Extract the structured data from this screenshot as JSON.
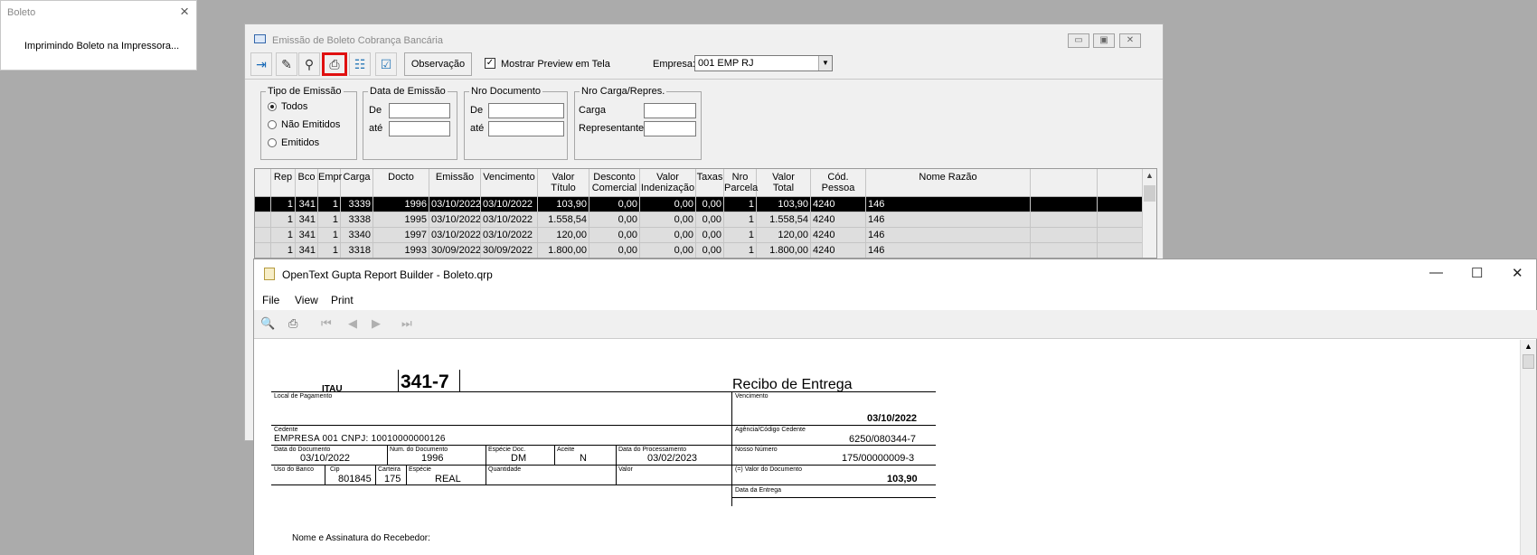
{
  "popup": {
    "title": "Boleto",
    "close": "×",
    "message": "Imprimindo Boleto na Impressora..."
  },
  "main_window": {
    "title": "Emissão de Boleto Cobrança Bancária",
    "controls": {
      "minimize": "▭",
      "restore": "▣",
      "close": "✕"
    },
    "toolbar": {
      "observacao_label": "Observação",
      "preview_checkbox": {
        "label": "Mostrar Preview em Tela",
        "checked": true,
        "mark": "✓"
      },
      "empresa_label": "Empresa:",
      "empresa_value": "001 EMP RJ",
      "empresa_arrow": "▼",
      "icons": {
        "exit": "⇥",
        "edit": "✎",
        "search": "⚲",
        "print": "⎙",
        "select_all": "☷",
        "check_all": "☑"
      }
    },
    "filters": {
      "tipo_emissao": {
        "title": "Tipo de Emissão",
        "options": [
          {
            "label": "Todos",
            "selected": true
          },
          {
            "label": "Não Emitidos",
            "selected": false
          },
          {
            "label": "Emitidos",
            "selected": false
          }
        ]
      },
      "data_emissao": {
        "title": "Data de Emissão",
        "de_label": "De",
        "ate_label": "até",
        "de_value": "",
        "ate_value": ""
      },
      "nro_documento": {
        "title": "Nro Documento",
        "de_label": "De",
        "ate_label": "até",
        "de_value": "",
        "ate_value": ""
      },
      "nro_carga": {
        "title": "Nro Carga/Repres.",
        "carga_label": "Carga",
        "representante_label": "Representante",
        "carga_value": "",
        "representante_value": ""
      }
    },
    "grid": {
      "columns": [
        {
          "l1": "Rep",
          "l2": ""
        },
        {
          "l1": "Bco",
          "l2": ""
        },
        {
          "l1": "Empr",
          "l2": ""
        },
        {
          "l1": "Carga",
          "l2": ""
        },
        {
          "l1": "Docto",
          "l2": ""
        },
        {
          "l1": "Emissão",
          "l2": ""
        },
        {
          "l1": "Vencimento",
          "l2": ""
        },
        {
          "l1": "Valor",
          "l2": "Título"
        },
        {
          "l1": "Desconto",
          "l2": "Comercial"
        },
        {
          "l1": "Valor",
          "l2": "Indenização"
        },
        {
          "l1": "Taxas",
          "l2": ""
        },
        {
          "l1": "Nro",
          "l2": "Parcela"
        },
        {
          "l1": "Valor",
          "l2": "Total"
        },
        {
          "l1": "Cód.",
          "l2": "Pessoa"
        },
        {
          "l1": "Nome Razão",
          "l2": ""
        },
        {
          "l1": "",
          "l2": ""
        }
      ],
      "rows": [
        [
          "1",
          "341",
          "1",
          "3339",
          "1996",
          "03/10/2022",
          "03/10/2022",
          "103,90",
          "0,00",
          "0,00",
          "0,00",
          "1",
          "103,90",
          "4240",
          "146",
          ""
        ],
        [
          "1",
          "341",
          "1",
          "3338",
          "1995",
          "03/10/2022",
          "03/10/2022",
          "1.558,54",
          "0,00",
          "0,00",
          "0,00",
          "1",
          "1.558,54",
          "4240",
          "146",
          ""
        ],
        [
          "1",
          "341",
          "1",
          "3340",
          "1997",
          "03/10/2022",
          "03/10/2022",
          "120,00",
          "0,00",
          "0,00",
          "0,00",
          "1",
          "120,00",
          "4240",
          "146",
          ""
        ],
        [
          "1",
          "341",
          "1",
          "3318",
          "1993",
          "30/09/2022",
          "30/09/2022",
          "1.800,00",
          "0,00",
          "0,00",
          "0,00",
          "1",
          "1.800,00",
          "4240",
          "146",
          ""
        ]
      ],
      "scroll_up": "▲"
    }
  },
  "report_window": {
    "title": "OpenText Gupta Report Builder - Boleto.qrp",
    "controls": {
      "minimize": "—",
      "maximize": "☐",
      "close": "✕"
    },
    "menu": [
      "File",
      "View",
      "Print"
    ],
    "tools": {
      "preview": "🔍",
      "print": "⎙",
      "first": "⏮",
      "prev": "◀",
      "next": "▶",
      "last": "⏭"
    },
    "scroll_up": "▲",
    "boleto": {
      "bank_name": "ITAU",
      "bank_code": "341-7",
      "receipt_title": "Recibo de Entrega",
      "local_pagamento_label": "Local de Pagamento",
      "vencimento_label": "Vencimento",
      "vencimento_value": "03/10/2022",
      "cedente_label": "Cedente",
      "cedente_value": "EMPRESA 001 CNPJ: 10010000000126",
      "agencia_label": "Agência/Código Cedente",
      "agencia_value": "6250/080344-7",
      "data_documento_label": "Data do Documento",
      "data_documento_value": "03/10/2022",
      "num_documento_label": "Num. do Documento",
      "num_documento_value": "1996",
      "especie_doc_label": "Espécie Doc.",
      "especie_doc_value": "DM",
      "aceite_label": "Aceite",
      "aceite_value": "N",
      "data_processamento_label": "Data do Processamento",
      "data_processamento_value": "03/02/2023",
      "nosso_numero_label": "Nosso Número",
      "nosso_numero_value": "175/00000009-3",
      "uso_banco_label": "Uso do Banco",
      "cip_label": "Cip",
      "cip_value": "801845",
      "carteira_label": "Carteira",
      "carteira_value": "175",
      "especie_label": "Espécie",
      "especie_value": "REAL",
      "quantidade_label": "Quantidade",
      "valor_label": "Valor",
      "valor_documento_label": "(=) Valor do Documento",
      "valor_documento_value": "103,90",
      "data_entrega_label": "Data da Entrega",
      "assinatura_label": "Nome e Assinatura do Recebedor:"
    }
  }
}
